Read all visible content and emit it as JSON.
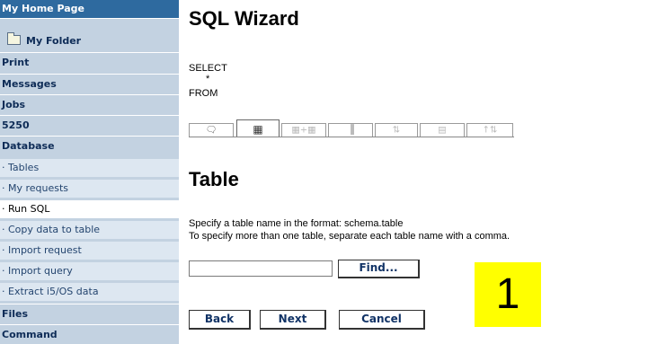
{
  "sidebar": {
    "home": "My Home Page",
    "folder": "My Folder",
    "print": "Print",
    "messages": "Messages",
    "jobs": "Jobs",
    "t5250": "5250",
    "database": "Database",
    "sub": {
      "tables": "· Tables",
      "my_requests": "· My requests",
      "run_sql": "· Run SQL",
      "copy_data": "· Copy data to table",
      "import_request": "· Import request",
      "import_query": "· Import query",
      "extract": "· Extract i5/OS data"
    },
    "files": "Files",
    "command": "Command"
  },
  "main": {
    "title": "SQL Wizard",
    "sql": {
      "select": "SELECT",
      "star": "*",
      "from": "FROM"
    },
    "tabs": [
      {
        "icon": "speech-bubble-icon"
      },
      {
        "icon": "table-icon"
      },
      {
        "icon": "join-tables-icon"
      },
      {
        "icon": "column-icon"
      },
      {
        "icon": "sort-icon"
      },
      {
        "icon": "form-icon"
      },
      {
        "icon": "order-icon"
      }
    ],
    "section_title": "Table",
    "instruction_1": "Specify a table name in the format: schema.table",
    "instruction_2": "To specify more than one table, separate each table name with a comma.",
    "table_input_value": "",
    "find_label": "Find...",
    "back_label": "Back",
    "next_label": "Next",
    "cancel_label": "Cancel"
  },
  "annotation": {
    "number": "1",
    "color": "#ffff00"
  },
  "colors": {
    "nav_header": "#2e6a9f",
    "nav_bg": "#c3d2e1",
    "nav_sub_bg": "#dde7f1",
    "nav_text": "#0e2c57"
  }
}
